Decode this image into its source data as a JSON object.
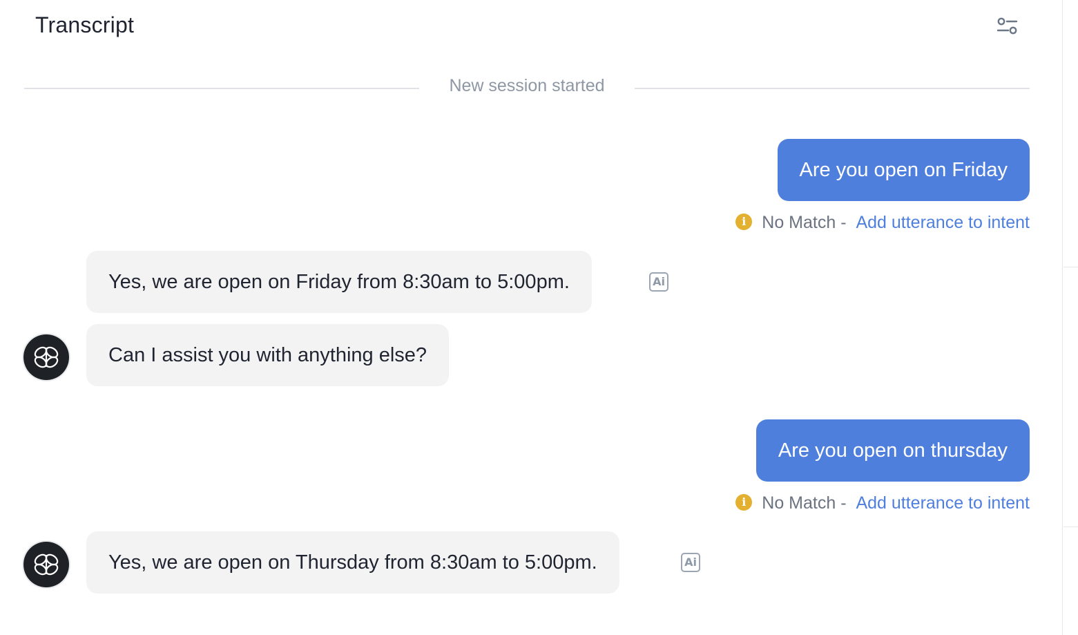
{
  "header": {
    "title": "Transcript",
    "filter_icon": "sliders-filter-icon"
  },
  "session": {
    "started_label": "New session started"
  },
  "messages": [
    {
      "role": "user",
      "text": "Are you open on Friday",
      "status": {
        "label": "No Match -",
        "action": "Add utterance to intent"
      }
    },
    {
      "role": "bot",
      "text": "Yes, we are open on Friday from 8:30am to 5:00pm.",
      "badge": "Ai"
    },
    {
      "role": "bot",
      "text": "Can I assist you with anything else?"
    },
    {
      "role": "user",
      "text": "Are you open on thursday",
      "status": {
        "label": "No Match -",
        "action": "Add utterance to intent"
      }
    },
    {
      "role": "bot",
      "text": "Yes, we are open on Thursday from 8:30am to 5:00pm.",
      "badge": "Ai"
    }
  ],
  "colors": {
    "user_bubble": "#4f7fdd",
    "bot_bubble": "#f3f3f4",
    "link": "#4f7fdd",
    "warning": "#e3b12f",
    "avatar_bg": "#1e2126"
  }
}
